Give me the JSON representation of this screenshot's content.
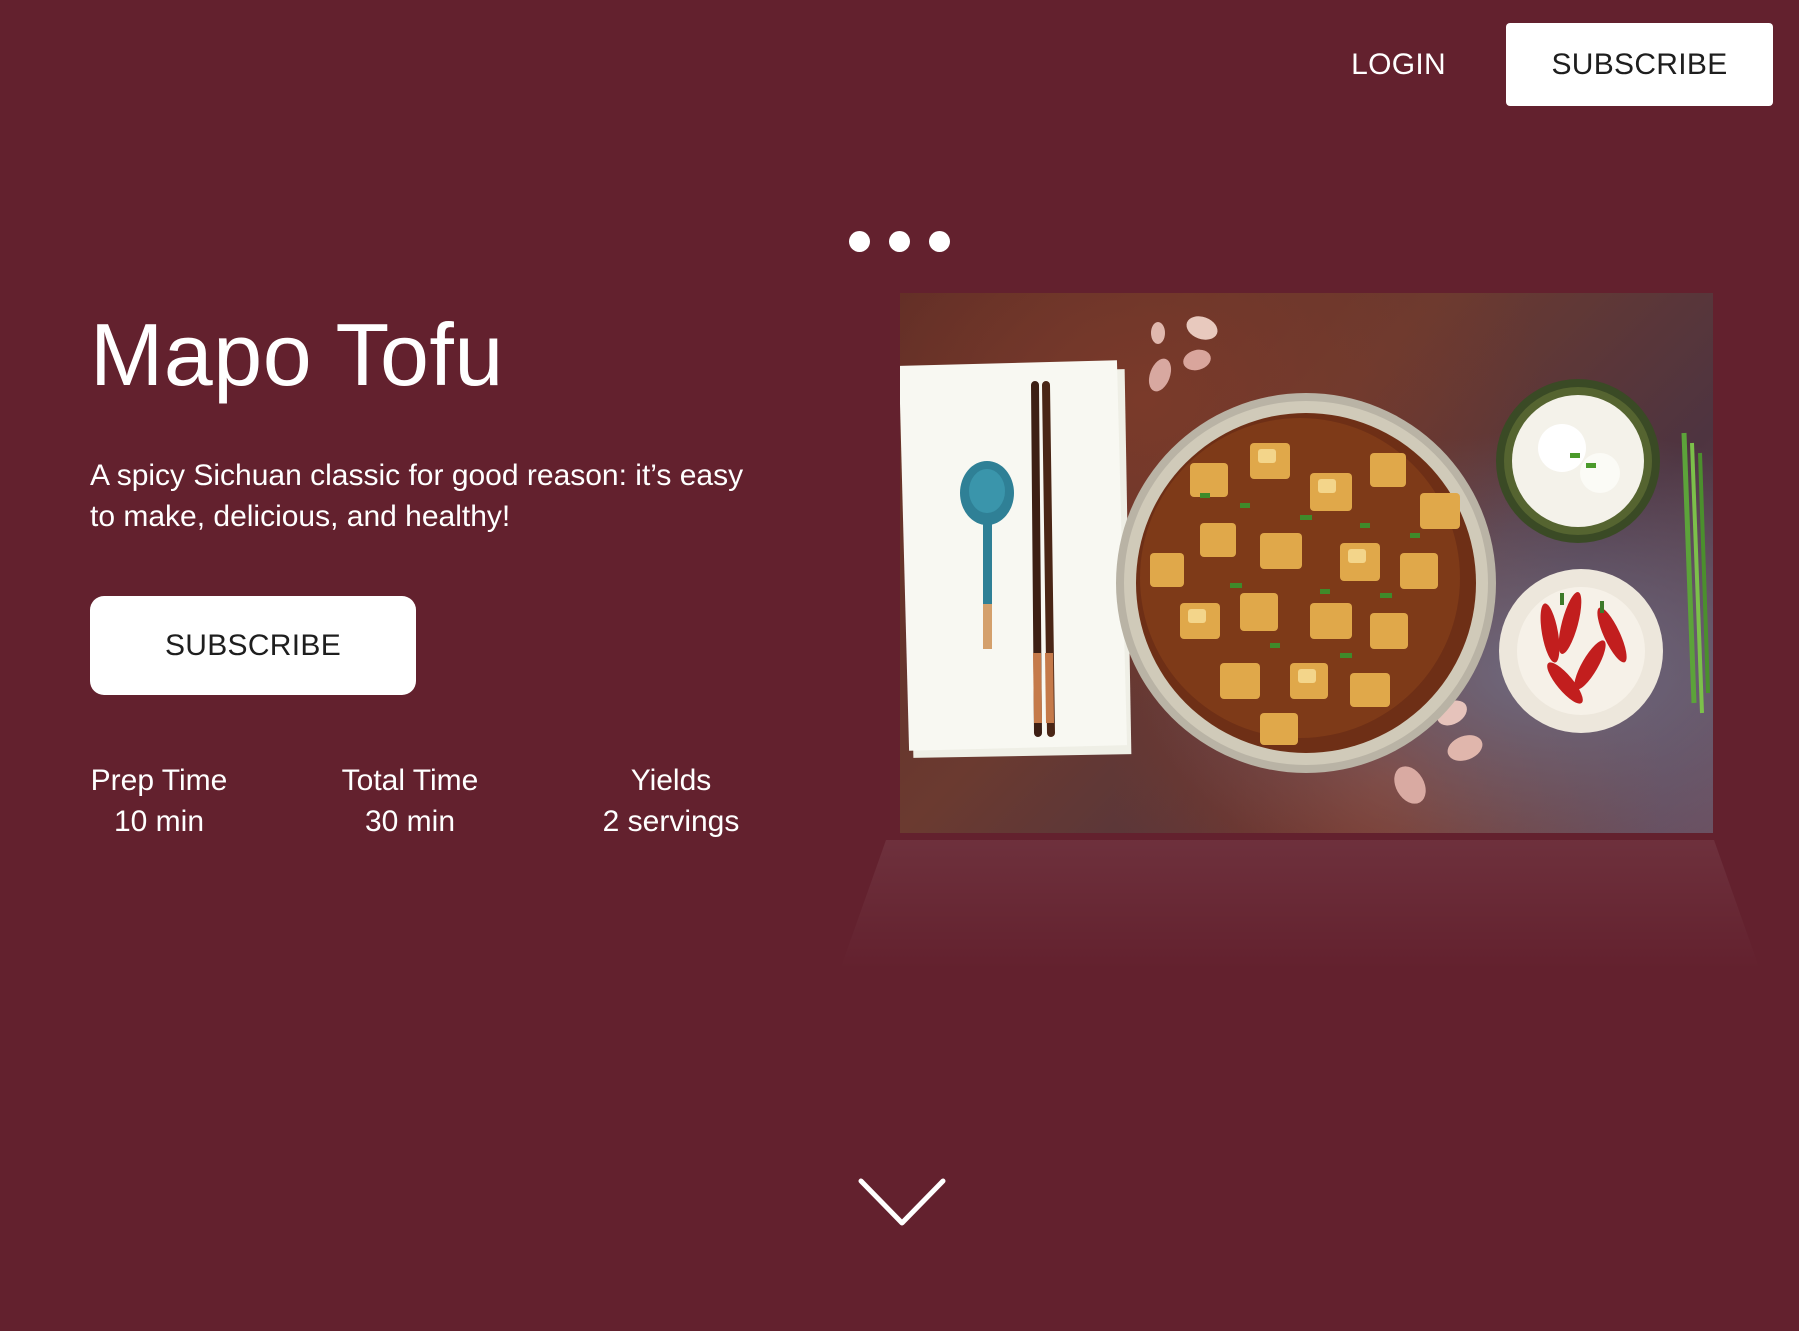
{
  "nav": {
    "login_label": "LOGIN",
    "subscribe_label": "SUBSCRIBE"
  },
  "carousel": {
    "slide_count": 3
  },
  "hero": {
    "title": "Mapo Tofu",
    "description": "A spicy Sichuan classic for good reason: it’s easy to make, delicious, and healthy!",
    "cta_label": "SUBSCRIBE"
  },
  "stats": [
    {
      "label": "Prep Time",
      "value": "10 min"
    },
    {
      "label": "Total Time",
      "value": "30 min"
    },
    {
      "label": "Yields",
      "value": "2 servings"
    }
  ],
  "icons": {
    "scroll": "chevron-down-icon"
  },
  "colors": {
    "background": "#63212e",
    "button_bg": "#ffffff",
    "button_text": "#1e1e1e",
    "text": "#ffffff"
  }
}
